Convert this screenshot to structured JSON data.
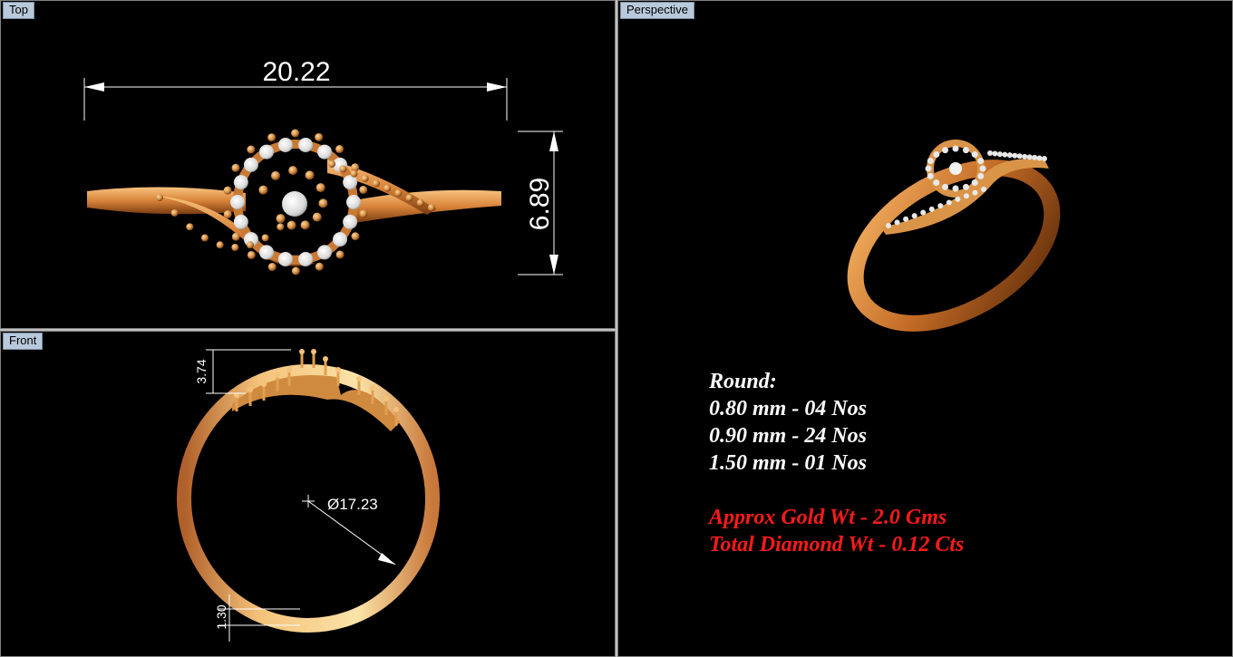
{
  "viewports": {
    "top": {
      "label": "Top",
      "width_dim": "20.22",
      "height_dim": "6.89"
    },
    "front": {
      "label": "Front",
      "diameter_dim": "Ø17.23",
      "height_dim": "3.74",
      "band_dim": "1.30"
    },
    "perspective": {
      "label": "Perspective"
    }
  },
  "specs": {
    "heading": "Round:",
    "stones": [
      "0.80 mm - 04 Nos",
      "0.90 mm - 24 Nos",
      "1.50 mm - 01 Nos"
    ],
    "gold_weight": "Approx Gold Wt - 2.0 Gms",
    "diamond_weight": "Total Diamond Wt - 0.12 Cts"
  },
  "colors": {
    "viewport_bg": "#000000",
    "gold": "#d98a3c",
    "gold_light": "#f4c27a",
    "diamond": "#e6e6e6",
    "warning_text": "#ff1a1a"
  }
}
